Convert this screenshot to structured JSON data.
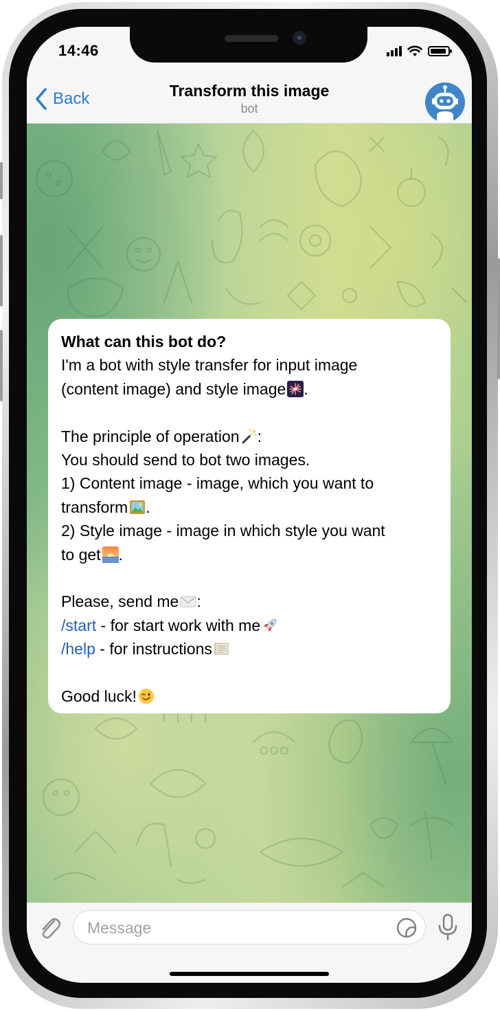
{
  "status_bar": {
    "time": "14:46",
    "icons": [
      "signal-icon",
      "wifi-icon",
      "battery-icon"
    ]
  },
  "header": {
    "back_label": "Back",
    "title": "Transform this image",
    "subtitle": "bot",
    "avatar_icon": "robot-icon",
    "accent_color": "#2b7cd3"
  },
  "message": {
    "heading": "What can this bot do?",
    "lines": {
      "l1": "I'm a bot with style transfer for input image",
      "l2": "(content image) and style image",
      "l2_tail": ".",
      "l4": "The principle of operation",
      "l4_tail": ":",
      "l5": "You should send to bot two images.",
      "l6": "1) Content image - image, which you want to",
      "l7": "transform",
      "l7_tail": ".",
      "l8": "2) Style image - image in which style you want",
      "l9": "to get",
      "l9_tail": ".",
      "l11": "Please, send me",
      "l11_tail": ":",
      "l12_cmd": "/start",
      "l12": " - for start work with me",
      "l13_cmd": "/help",
      "l13": " - for instructions",
      "l15": "Good luck!"
    },
    "emoji_icons": [
      "fireworks-icon",
      "magic-wand-icon",
      "framed-picture-icon",
      "sunrise-icon",
      "envelope-icon",
      "rocket-icon",
      "scroll-icon",
      "winking-face-icon"
    ],
    "link_color": "#2160b4"
  },
  "input_bar": {
    "placeholder": "Message",
    "icons": [
      "paperclip-icon",
      "sticker-icon",
      "microphone-icon"
    ]
  }
}
